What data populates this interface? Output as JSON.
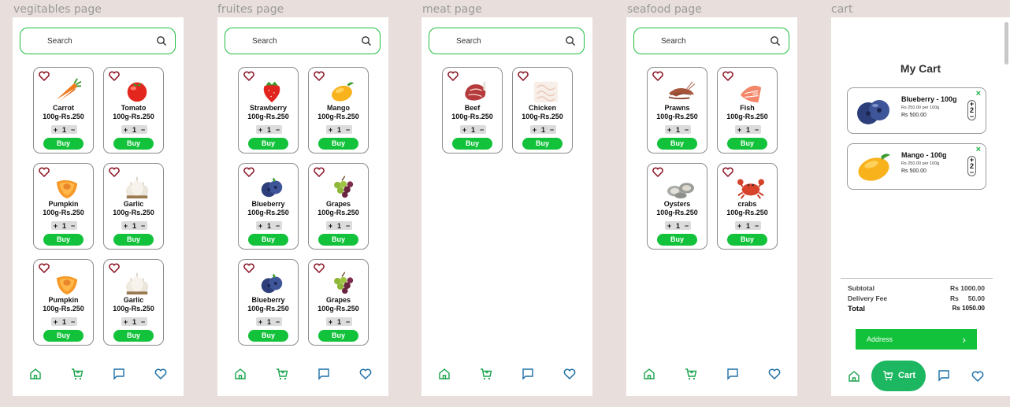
{
  "frames": {
    "vegetables": "vegitables page",
    "fruits": "fruites page",
    "meat": "meat page",
    "seafood": "seafood page",
    "cart": "cart"
  },
  "search": {
    "placeholder": "Search"
  },
  "stepper": {
    "minus": "−",
    "plus": "+",
    "value": "1"
  },
  "buy_label": "Buy",
  "vegetables": [
    {
      "name": "Carrot",
      "price": "100g-Rs.250",
      "icon": "carrot"
    },
    {
      "name": "Tomato",
      "price": "100g-Rs.250",
      "icon": "tomato"
    },
    {
      "name": "Pumpkin",
      "price": "100g-Rs.250",
      "icon": "pumpkin"
    },
    {
      "name": "Garlic",
      "price": "100g-Rs.250",
      "icon": "garlic"
    },
    {
      "name": "Pumpkin",
      "price": "100g-Rs.250",
      "icon": "pumpkin"
    },
    {
      "name": "Garlic",
      "price": "100g-Rs.250",
      "icon": "garlic"
    }
  ],
  "fruits": [
    {
      "name": "Strawberry",
      "price": "100g-Rs.250",
      "icon": "strawberry"
    },
    {
      "name": "Mango",
      "price": "100g-Rs.250",
      "icon": "mango"
    },
    {
      "name": "Blueberry",
      "price": "100g-Rs.250",
      "icon": "blueberry"
    },
    {
      "name": "Grapes",
      "price": "100g-Rs.250",
      "icon": "grapes"
    },
    {
      "name": "Blueberry",
      "price": "100g-Rs.250",
      "icon": "blueberry"
    },
    {
      "name": "Grapes",
      "price": "100g-Rs.250",
      "icon": "grapes"
    }
  ],
  "meat": [
    {
      "name": "Beef",
      "price": "100g-Rs.250",
      "icon": "beef"
    },
    {
      "name": "Chicken",
      "price": "100g-Rs.250",
      "icon": "chicken"
    }
  ],
  "seafood": [
    {
      "name": "Prawns",
      "price": "100g-Rs.250",
      "icon": "prawns"
    },
    {
      "name": "Fish",
      "price": "100g-Rs.250",
      "icon": "fish"
    },
    {
      "name": "Oysters",
      "price": "100g-Rs.250",
      "icon": "oysters"
    },
    {
      "name": "crabs",
      "price": "100g-Rs.250",
      "icon": "crab"
    }
  ],
  "cart": {
    "title": "My Cart",
    "items": [
      {
        "name": "Blueberry - 100g",
        "unit": "Rs 250.00 per 100g",
        "total": "Rs 500.00",
        "qty": "2",
        "icon": "blueberry"
      },
      {
        "name": "Mango - 100g",
        "unit": "Rs 250.00 per 100g",
        "total": "Rs 500.00",
        "qty": "2",
        "icon": "mango"
      }
    ],
    "summary": [
      {
        "label": "Subtotal",
        "value": "Rs 1000.00"
      },
      {
        "label": "Delivery Fee",
        "value": "Rs     50.00"
      },
      {
        "label": "Total",
        "value": "Rs 1050.00"
      }
    ],
    "address_label": "Address",
    "cart_nav_label": "Cart"
  },
  "nav_icons": [
    "home-icon",
    "cart-icon",
    "chat-icon",
    "heart-icon"
  ],
  "colors": {
    "accent": "#12c23b",
    "pill": "#1cb760",
    "heart": "#8a1020",
    "nav": "#1e6fa8"
  }
}
